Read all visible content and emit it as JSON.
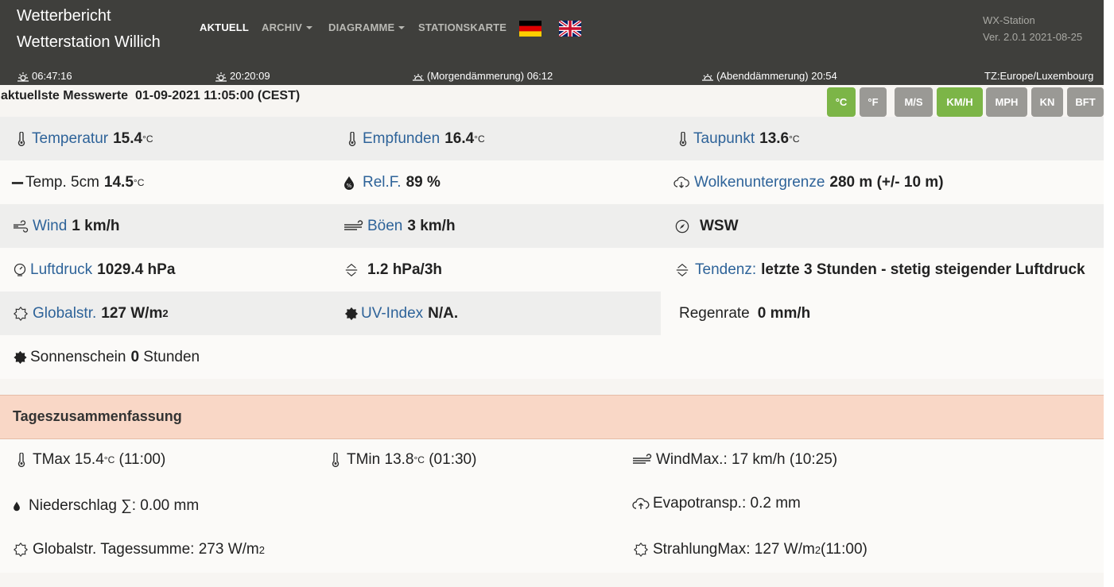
{
  "header": {
    "title_line1": "Wetterbericht",
    "title_line2": "Wetterstation Willich",
    "nav": [
      "AKTUELL",
      "ARCHIV",
      "DIAGRAMME",
      "STATIONSKARTE"
    ],
    "station_name": "WX-Station",
    "station_version": "Ver. 2.0.1 2021-08-25",
    "sunrise": "06:47:16",
    "sunset": "20:20:09",
    "dawn": "(Morgendämmerung) 06:12",
    "dusk": "(Abenddämmerung) 20:54",
    "timezone": "TZ:Europe/Luxembourg"
  },
  "current": {
    "heading_label": "aktuellste Messwerte",
    "heading_time": "01-09-2021 11:05:00 (CEST)",
    "units": [
      {
        "label": "°C",
        "active": true
      },
      {
        "label": "°F",
        "active": false
      },
      {
        "label": "M/S",
        "active": false
      },
      {
        "label": "KM/H",
        "active": true
      },
      {
        "label": "MPH",
        "active": false
      },
      {
        "label": "KN",
        "active": false
      },
      {
        "label": "BFT",
        "active": false
      }
    ],
    "temp_label": "Temperatur",
    "temp_value": "15.4",
    "temp_unit": "°C",
    "feels_label": "Empfunden",
    "feels_value": "16.4",
    "feels_unit": "°C",
    "dew_label": "Taupunkt",
    "dew_value": "13.6",
    "dew_unit": "°C",
    "temp5_label": "Temp. 5cm",
    "temp5_value": "14.5",
    "temp5_unit": "°C",
    "hum_label": "Rel.F.",
    "hum_value": "89 %",
    "cloud_label": "Wolkenuntergrenze",
    "cloud_value": "280 m (+/- 10 m)",
    "wind_label": "Wind",
    "wind_value": "1 km/h",
    "gust_label": "Böen",
    "gust_value": "3 km/h",
    "winddir_value": "WSW",
    "pressure_label": "Luftdruck",
    "pressure_value": "1029.4 hPa",
    "ptrend_value": "1.2 hPa/3h",
    "tendency_label": "Tendenz:",
    "tendency_value": "letzte 3 Stunden - stetig steigender Luftdruck",
    "rad_label": "Globalstr.",
    "rad_value": "127 W/m",
    "rad_sup": "2",
    "uv_label": "UV-Index",
    "uv_value": "N/A.",
    "rain_label": "Regenrate",
    "rain_value": "0 mm/h",
    "sun_label": "Sonnenschein",
    "sun_value": "0",
    "sun_unit": "Stunden"
  },
  "summary": {
    "title": "Tageszusammenfassung",
    "tmax": "TMax 15.4",
    "tmax_unit": "°C",
    "tmax_time": "(11:00)",
    "tmin": "TMin 13.8",
    "tmin_unit": "°C",
    "tmin_time": "(01:30)",
    "windmax": "WindMax.:  17 km/h (10:25)",
    "precip": "Niederschlag ∑:  0.00 mm",
    "evapo": "Evapotransp.: 0.2 mm",
    "radsum": "Globalstr. Tagessumme: 273 W/m",
    "radsum_sup": "2",
    "radmax": "StrahlungMax:  127 W/m",
    "radmax_sup": "2",
    "radmax_time": " (11:00)"
  }
}
